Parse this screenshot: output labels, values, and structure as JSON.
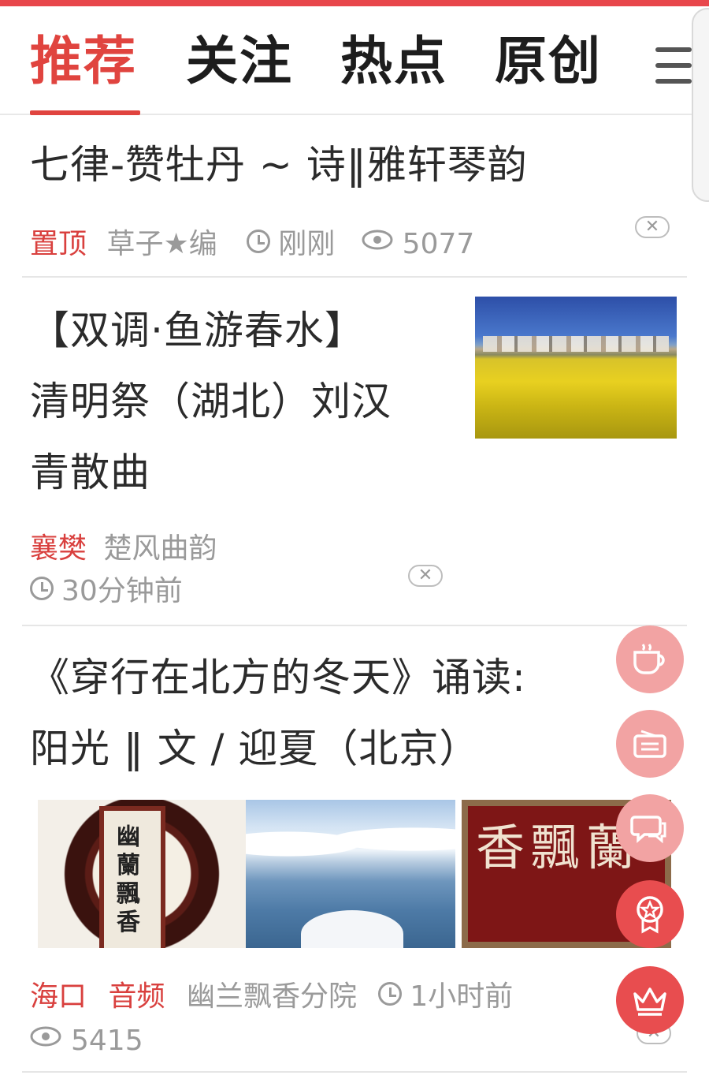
{
  "tabs": [
    {
      "label": "推荐",
      "active": true
    },
    {
      "label": "关注",
      "active": false
    },
    {
      "label": "热点",
      "active": false
    },
    {
      "label": "原创",
      "active": false
    }
  ],
  "menu_icon": "hamburger-menu-icon",
  "articles": [
    {
      "title": "七律-赞牡丹 ~ 诗‖雅轩琴韵",
      "tag": "置顶",
      "author": "草子★编",
      "time": "刚刚",
      "views": "5077",
      "close": "✕"
    },
    {
      "title_lines": [
        "【双调·鱼游春水】",
        "清明祭（湖北）刘汉",
        "青散曲"
      ],
      "tag": "襄樊",
      "author": "楚风曲韵",
      "time": "30分钟前",
      "close": "✕",
      "thumb": "rapeseed-field-image"
    },
    {
      "title_lines": [
        "《穿行在北方的冬天》诵读:",
        "阳光 ‖ 文 / 迎夏（北京）"
      ],
      "tags": [
        "海口",
        "音频"
      ],
      "author": "幽兰飘香分院",
      "time": "1小时前",
      "views": "5415",
      "close": "✕",
      "thumbs": [
        "calligraphy-scroll-image",
        "snowy-river-image",
        "red-calligraphy-image"
      ]
    }
  ],
  "fabs": [
    "coffee-cup-icon",
    "radio-icon",
    "chat-bubbles-icon",
    "badge-star-icon",
    "crown-icon"
  ],
  "colors": {
    "accent": "#e0443f",
    "fab_light": "#f2a3a3",
    "fab_strong": "#e84d4f",
    "meta_gray": "#9a9a9a"
  }
}
